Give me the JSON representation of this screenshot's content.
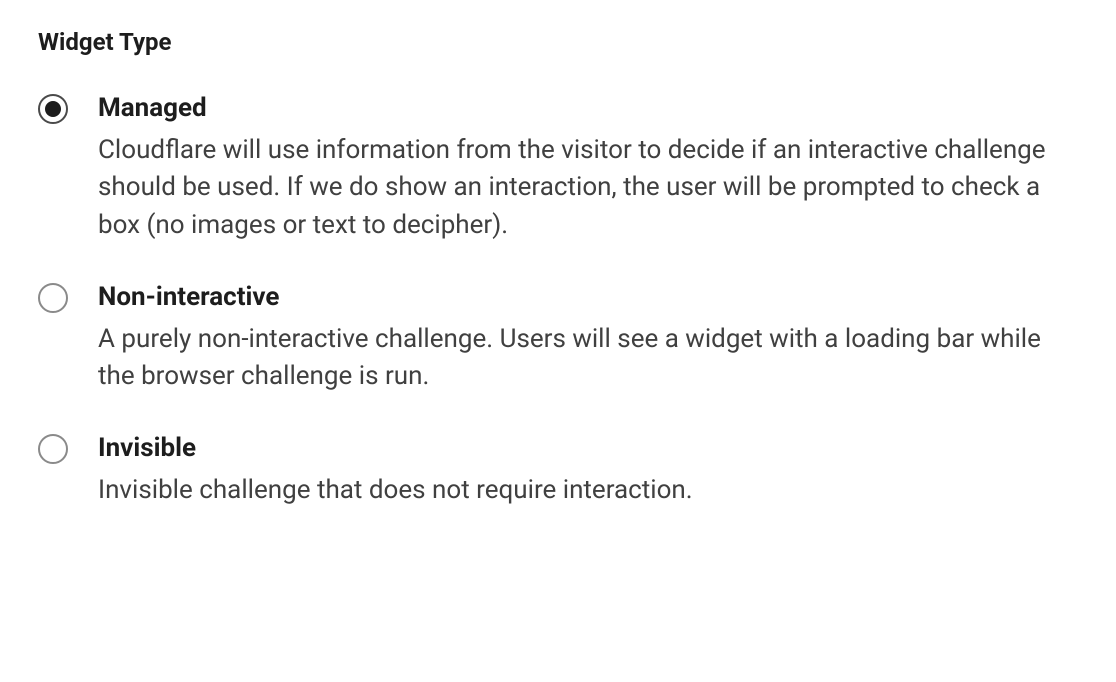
{
  "section": {
    "title": "Widget Type"
  },
  "options": [
    {
      "label": "Managed",
      "description": "Cloudflare will use information from the visitor to decide if an interactive challenge should be used. If we do show an interaction, the user will be prompted to check a box (no images or text to decipher).",
      "selected": true
    },
    {
      "label": "Non-interactive",
      "description": "A purely non-interactive challenge. Users will see a widget with a loading bar while the browser challenge is run.",
      "selected": false
    },
    {
      "label": "Invisible",
      "description": "Invisible challenge that does not require interaction.",
      "selected": false
    }
  ]
}
